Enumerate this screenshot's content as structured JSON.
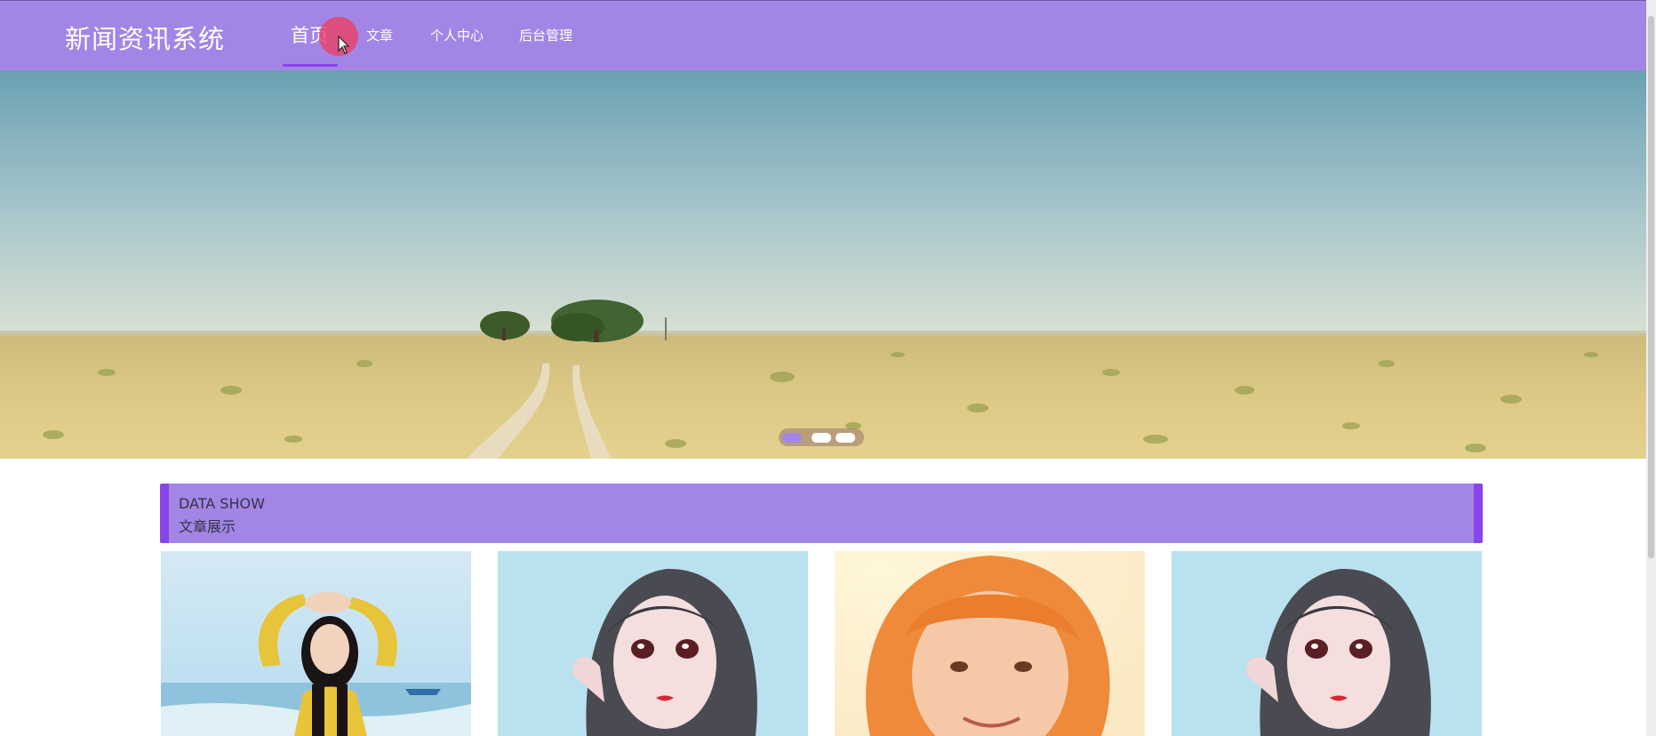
{
  "header": {
    "brand": "新闻资讯系统",
    "nav": [
      {
        "label": "首页",
        "active": true
      },
      {
        "label": "文章",
        "active": false
      },
      {
        "label": "个人中心",
        "active": false
      },
      {
        "label": "后台管理",
        "active": false
      }
    ]
  },
  "banner": {
    "image": "prairie-landscape-photo",
    "slide_count": 3,
    "active_slide": 1
  },
  "section": {
    "title_en": "DATA SHOW",
    "title_cn": "文章展示"
  },
  "articles": [
    {
      "image": "woman-yellow-sweater-beach-photo"
    },
    {
      "image": "anime-girl-illustration"
    },
    {
      "image": "girl-orange-hair-portrait"
    },
    {
      "image": "anime-girl-illustration"
    }
  ],
  "colors": {
    "accent": "#a385e6",
    "accent_dark": "#8a44e8",
    "click_indicator": "#e84268"
  }
}
